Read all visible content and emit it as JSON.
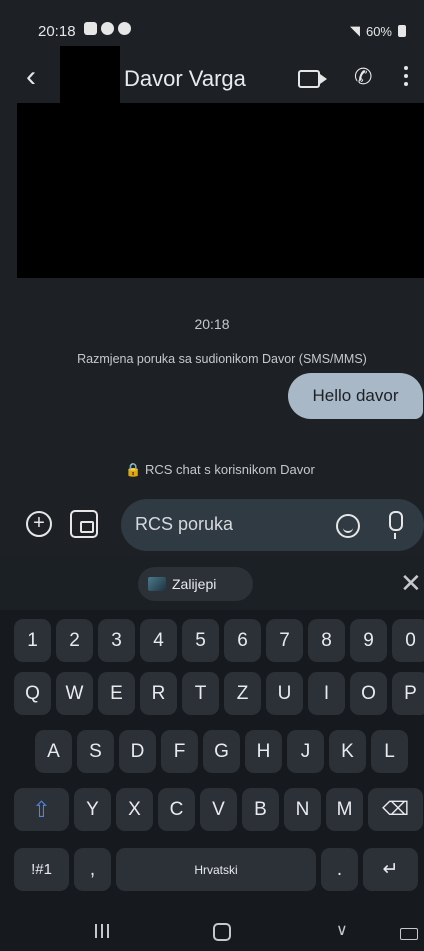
{
  "status_bar": {
    "time": "20:18",
    "right_text": "60%"
  },
  "header": {
    "contact_name": "Davor Varga"
  },
  "conversation": {
    "timestamp": "20:18",
    "system_message": "Razmjena poruka sa sudionikom Davor (SMS/MMS)",
    "outgoing_message": "Hello davor",
    "rcs_note": "🔒 RCS chat s korisnikom Davor"
  },
  "composer": {
    "placeholder": "RCS poruka"
  },
  "keyboard": {
    "suggestion_chip": "Zalijepi",
    "number_row": [
      "1",
      "2",
      "3",
      "4",
      "5",
      "6",
      "7",
      "8",
      "9",
      "0"
    ],
    "row1": [
      "Q",
      "W",
      "E",
      "R",
      "T",
      "Z",
      "U",
      "I",
      "O",
      "P"
    ],
    "row2": [
      "A",
      "S",
      "D",
      "F",
      "G",
      "H",
      "J",
      "K",
      "L"
    ],
    "row3": [
      "Y",
      "X",
      "C",
      "V",
      "B",
      "N",
      "M"
    ],
    "symbols_key": "!#1",
    "comma_key": ",",
    "space_label": "Hrvatski",
    "period_key": "."
  },
  "icons": {
    "back": "arrow-left-icon",
    "video": "video-call-icon",
    "phone": "phone-icon",
    "more": "more-vert-icon",
    "add": "add-circle-icon",
    "gallery": "gallery-icon",
    "emoji": "emoji-icon",
    "mic": "mic-icon",
    "close": "close-icon",
    "shift": "shift-icon",
    "backspace": "backspace-icon",
    "enter": "enter-icon"
  },
  "colors": {
    "background": "#1d2126",
    "bubble": "#a9b8c7",
    "shift": "#4a86e8"
  }
}
